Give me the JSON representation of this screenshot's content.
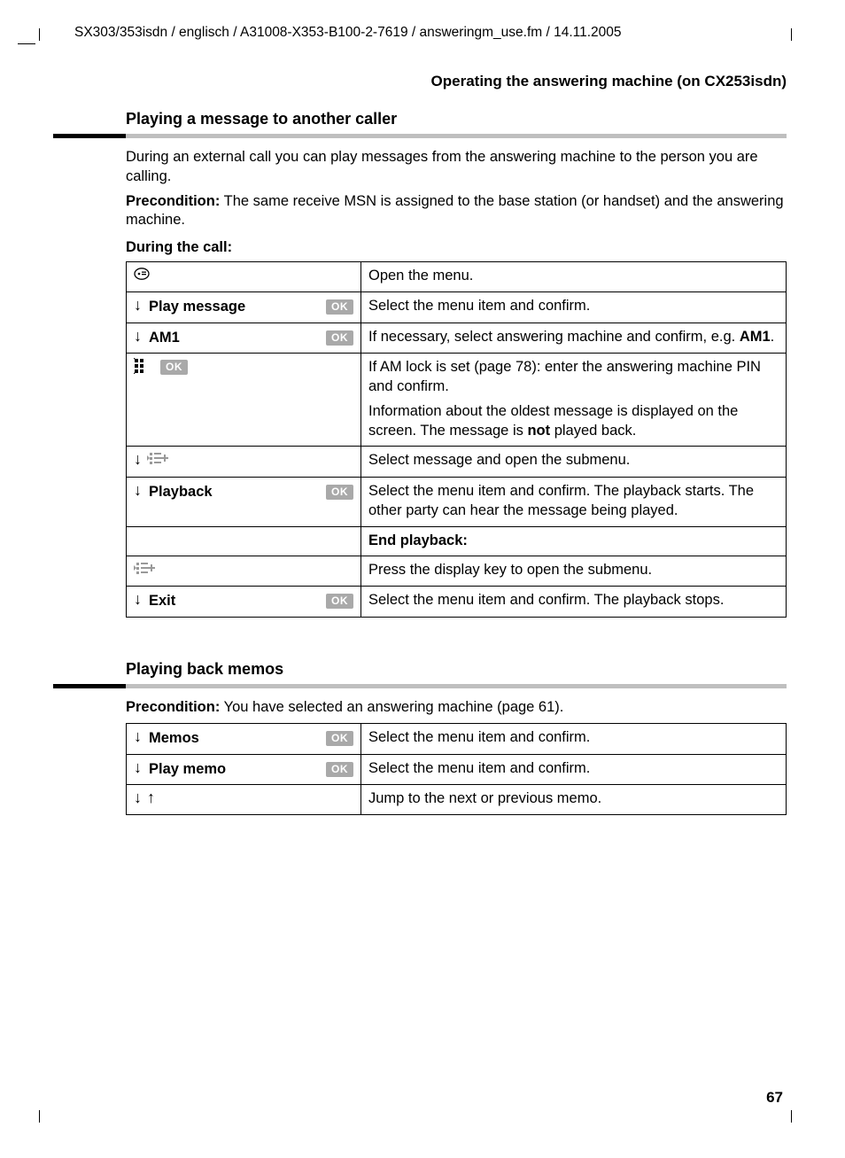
{
  "header_path": "SX303/353isdn / englisch / A31008-X353-B100-2-7619 / answeringm_use.fm / 14.11.2005",
  "running_header": "Operating the answering machine   (on CX253isdn)",
  "page_number": "67",
  "section1": {
    "heading": "Playing a message to another caller",
    "para1": "During an external call you can play messages from the answering machine to the person you are calling.",
    "precondition_label": "Precondition:",
    "precondition_text": " The same receive MSN is assigned to the base station (or handset) and the answering machine.",
    "subhead": "During the call:",
    "rows": {
      "r0": {
        "desc": "Open the menu."
      },
      "r1": {
        "label": "Play message",
        "ok": "OK",
        "desc": "Select the menu item and confirm."
      },
      "r2": {
        "label": "AM1",
        "ok": "OK",
        "desc_a": "If necessary, select answering machine and confirm, e.g. ",
        "desc_b": "AM1",
        "desc_c": "."
      },
      "r3": {
        "ok": "OK",
        "desc_a": "If AM lock is set (page 78): enter the answering machine PIN and confirm.",
        "desc_b": "Information about the oldest message is displayed on the screen. The message is ",
        "desc_not": "not",
        "desc_c": " played back."
      },
      "r4": {
        "desc": "Select message and open the submenu."
      },
      "r5": {
        "label": "Playback",
        "ok": "OK",
        "desc": "Select the menu item and confirm. The playback starts. The other party can hear the message being played."
      },
      "r6": {
        "desc": "End playback:"
      },
      "r7": {
        "desc": "Press the display key to open the submenu."
      },
      "r8": {
        "label": "Exit",
        "ok": "OK",
        "desc": "Select the menu item and confirm. The playback stops."
      }
    }
  },
  "section2": {
    "heading": "Playing back memos",
    "precondition_label": "Precondition:",
    "precondition_text": " You have selected an answering machine (page 61).",
    "rows": {
      "r0": {
        "label": "Memos",
        "ok": "OK",
        "desc": "Select the menu item and confirm."
      },
      "r1": {
        "label": "Play memo",
        "ok": "OK",
        "desc": "Select the menu item and confirm."
      },
      "r2": {
        "desc": "Jump to the next or previous memo."
      }
    }
  }
}
